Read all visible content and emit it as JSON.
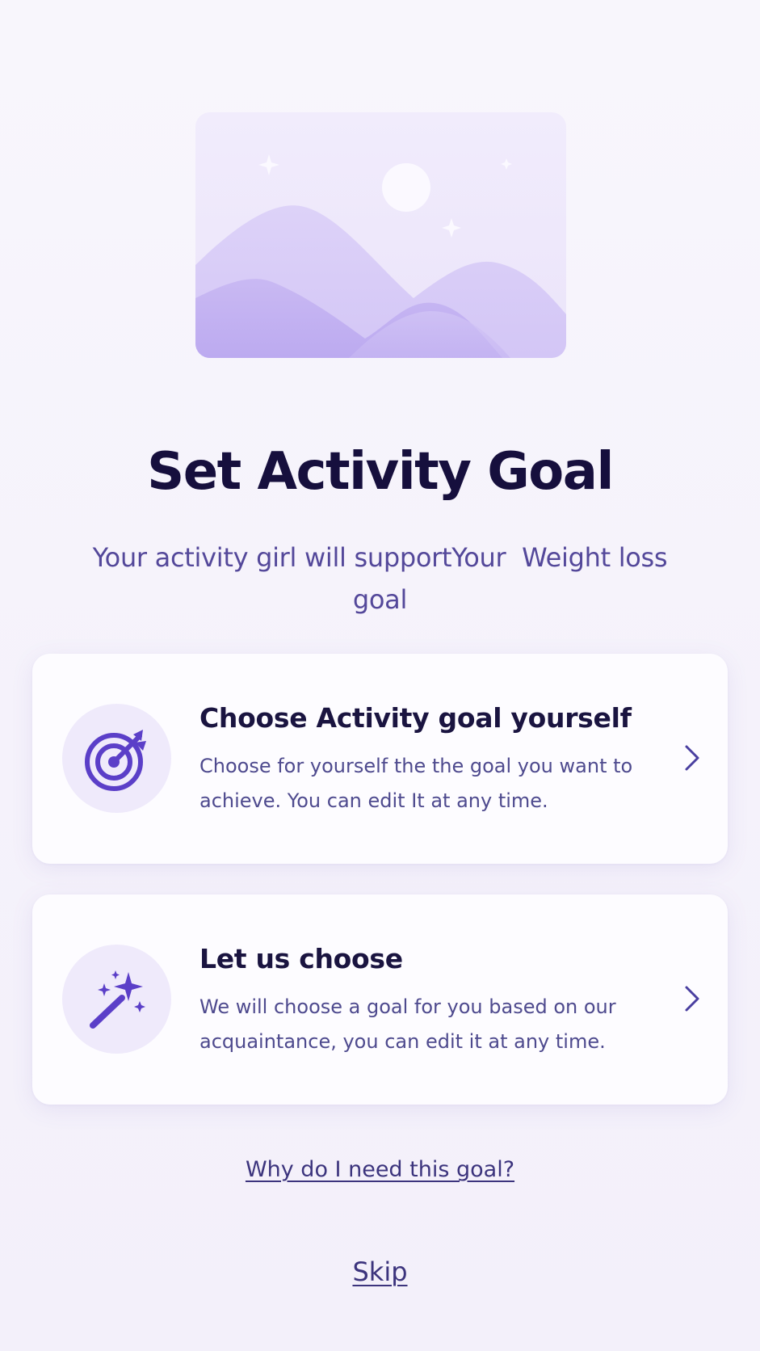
{
  "colors": {
    "title": "#160f3d",
    "subtitle": "#54489a",
    "accent": "#5b3fc8",
    "card_background": "#fdfcff",
    "icon_circle": "#efeafb"
  },
  "hero": {
    "icon": "mountain-landscape-illustration"
  },
  "header": {
    "title": "Set Activity Goal",
    "subtitle": "Your activity girl will supportYour  Weight loss goal"
  },
  "options": [
    {
      "icon": "target-arrow-icon",
      "title": "Choose Activity goal yourself",
      "description": "Choose for yourself the the goal you want to achieve. You can edit It at any time.",
      "chevron_icon": "chevron-right-icon"
    },
    {
      "icon": "magic-wand-icon",
      "title": "Let us choose",
      "description": "We will choose a goal for you based on our acquaintance, you can edit it at any time.",
      "chevron_icon": "chevron-right-icon"
    }
  ],
  "links": {
    "why": "Why do I need this goal?",
    "skip": "Skip"
  }
}
